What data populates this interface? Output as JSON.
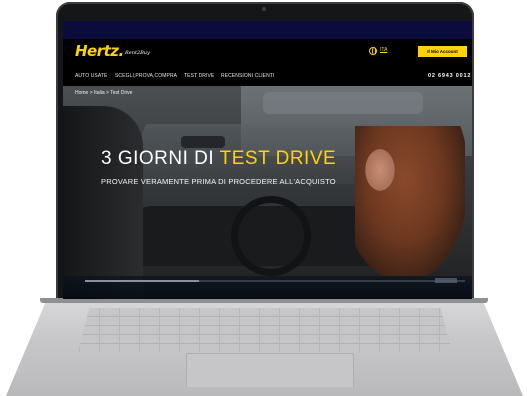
{
  "brand": {
    "logo": "Hertz.",
    "logo_sub": "Rent2Buy",
    "accent_color": "#ffd400"
  },
  "header": {
    "lang_icon": "globe-icon",
    "lang_label": "ITA",
    "account_button": "Il Mio Account"
  },
  "nav": {
    "items": [
      {
        "label": "AUTO USATE"
      },
      {
        "label": "SCEGLI,PROVA,COMPRA"
      },
      {
        "label": "TEST DRIVE"
      },
      {
        "label": "RECENSIONI CLIENTI"
      }
    ],
    "phone": "02 6943 0012"
  },
  "breadcrumb": "Home > Italia > Test Drive",
  "hero": {
    "title_main": "3 GIORNI DI ",
    "title_highlight": "TEST DRIVE",
    "subtitle": "PROVARE VERAMENTE PRIMA DI PROCEDERE ALL'ACQUISTO",
    "slider_progress": 0.3
  }
}
